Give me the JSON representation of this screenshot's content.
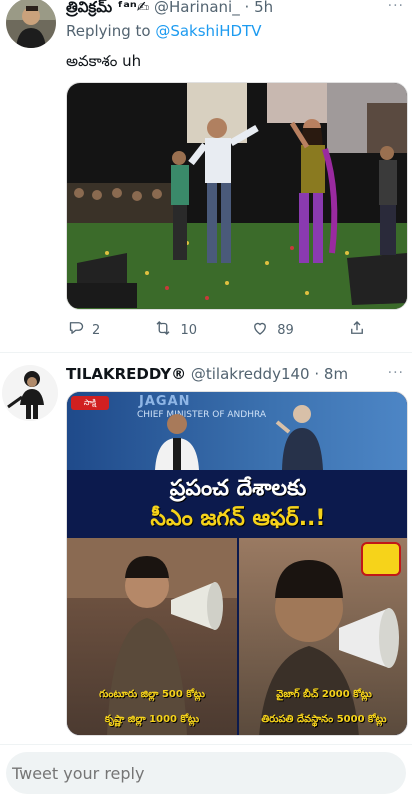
{
  "tweet1": {
    "name": "త్రివిక్రమ్ ᶠᵃⁿ✍",
    "handle": "@Harinani_",
    "dot": "·",
    "time": "5h",
    "more": "···",
    "replying_prefix": "Replying to ",
    "replying_handle": "@SakshiHDTV",
    "text": "అవకాశం uh",
    "actions": {
      "replies": "2",
      "retweets": "10",
      "likes": "89"
    }
  },
  "tweet2": {
    "name": "TILAKREDDY®",
    "handle": "@tilakreddy140",
    "dot": "·",
    "time": "8m",
    "more": "···",
    "media": {
      "headline_line1": "ప్రపంచ దేశాలకు",
      "headline_line2": "సీఎం జగన్ ఆఫర్..!",
      "screen_text_1": "CHIEF MINISTER OF ANDHRA",
      "screen_text_2": "JAGAN",
      "caption_left_1": "గుంటూరు జిల్లా 500 కోట్లు",
      "caption_left_2": "కృష్ణా జిల్లా 1000 కోట్లు",
      "caption_right_1": "వైజాగ్ బీచ్  2000 కోట్లు",
      "caption_right_2": "తిరుపతి దేవస్థానం 5000 కోట్లు",
      "logo_text": "సాక్షి"
    }
  },
  "reply": {
    "placeholder": "Tweet your reply"
  },
  "colors": {
    "accent": "#1d9bf0",
    "muted": "#536471",
    "banner_bg": "#0c1a4d",
    "banner_yellow": "#f6d31a"
  }
}
